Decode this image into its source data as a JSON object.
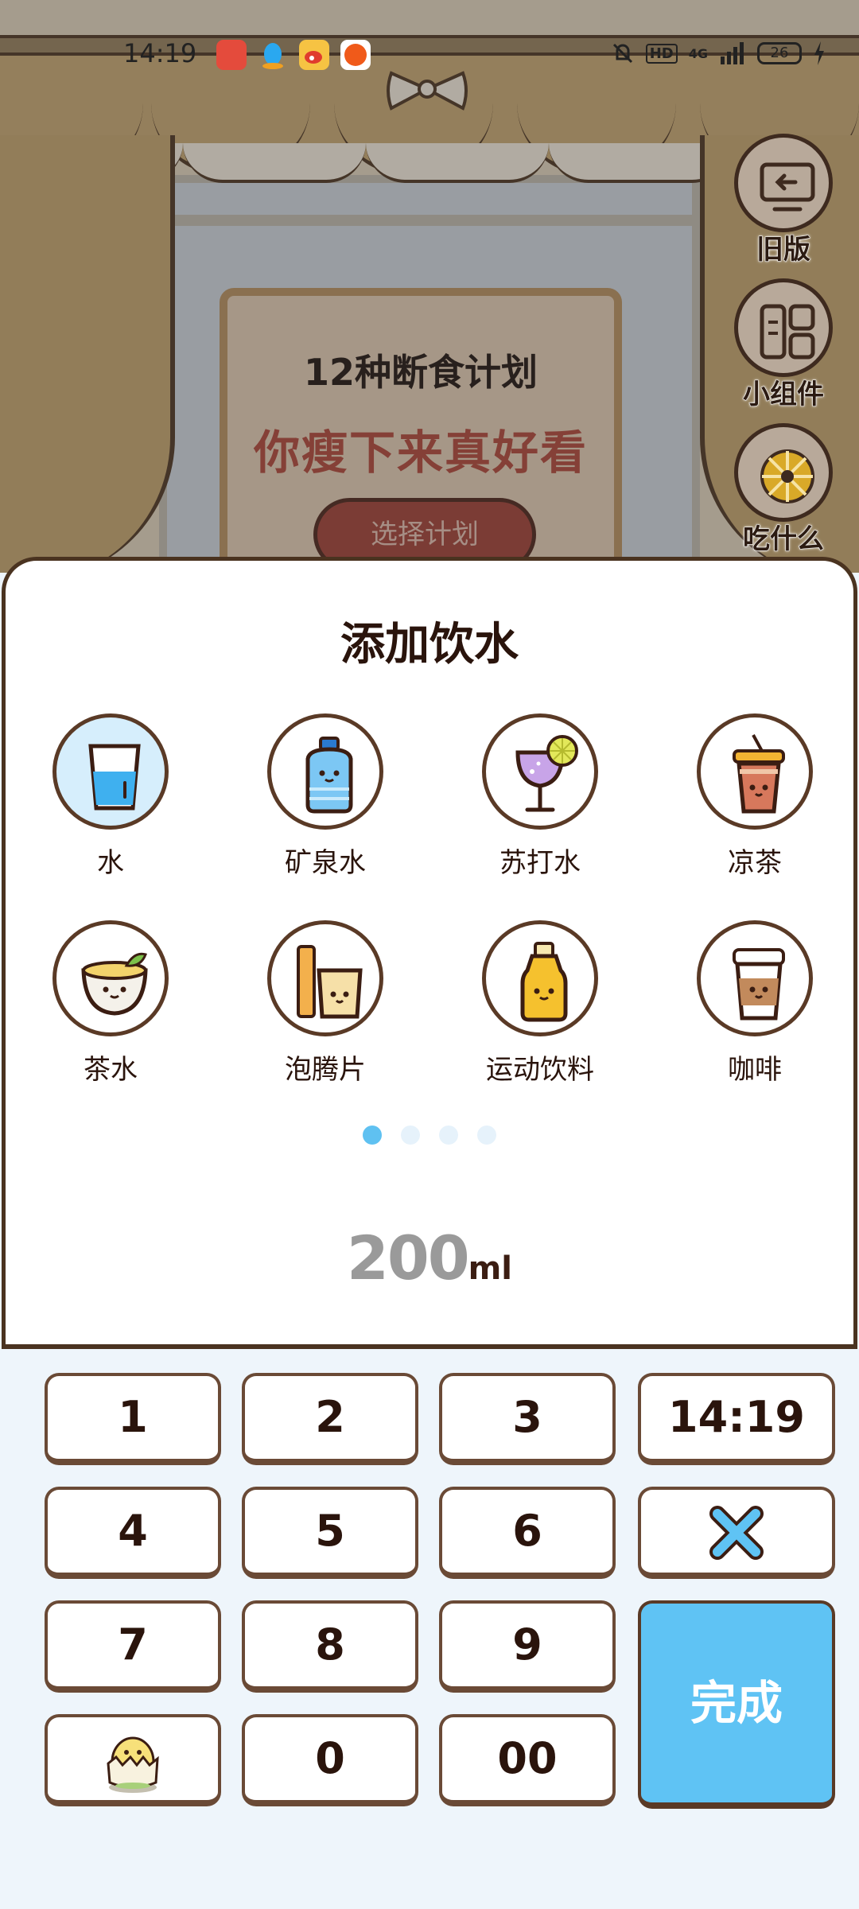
{
  "status_bar": {
    "time": "14:19",
    "network": "4G",
    "hd": "HD",
    "battery": "26"
  },
  "background": {
    "plan_title": "12种断食计划",
    "plan_slogan": "你瘦下来真好看",
    "plan_button": "选择计划",
    "side_buttons": [
      {
        "label": "旧版",
        "icon": "back-screen-icon"
      },
      {
        "label": "小组件",
        "icon": "widget-grid-icon"
      },
      {
        "label": "吃什么",
        "icon": "food-wheel-icon"
      }
    ]
  },
  "sheet": {
    "title": "添加饮水",
    "drinks": [
      {
        "label": "水",
        "icon": "water-glass-icon",
        "selected": true
      },
      {
        "label": "矿泉水",
        "icon": "mineral-water-bottle-icon"
      },
      {
        "label": "苏打水",
        "icon": "soda-glass-icon"
      },
      {
        "label": "凉茶",
        "icon": "herbal-tea-cup-icon"
      },
      {
        "label": "茶水",
        "icon": "tea-cup-icon"
      },
      {
        "label": "泡腾片",
        "icon": "effervescent-tablet-icon"
      },
      {
        "label": "运动饮料",
        "icon": "sports-drink-icon"
      },
      {
        "label": "咖啡",
        "icon": "coffee-cup-icon"
      }
    ],
    "page_count": 4,
    "current_page": 1,
    "amount_value": "200",
    "amount_unit": "ml"
  },
  "keypad": {
    "keys": [
      "1",
      "2",
      "3",
      "4",
      "5",
      "6",
      "7",
      "8",
      "9",
      "0",
      "00"
    ],
    "time_key": "14:19",
    "delete_icon": "delete-x-icon",
    "mascot_icon": "egg-mascot-icon",
    "done_label": "完成"
  },
  "colors": {
    "accent": "#5fc3f4",
    "border": "#5a3a26",
    "slogan": "#a84336"
  }
}
